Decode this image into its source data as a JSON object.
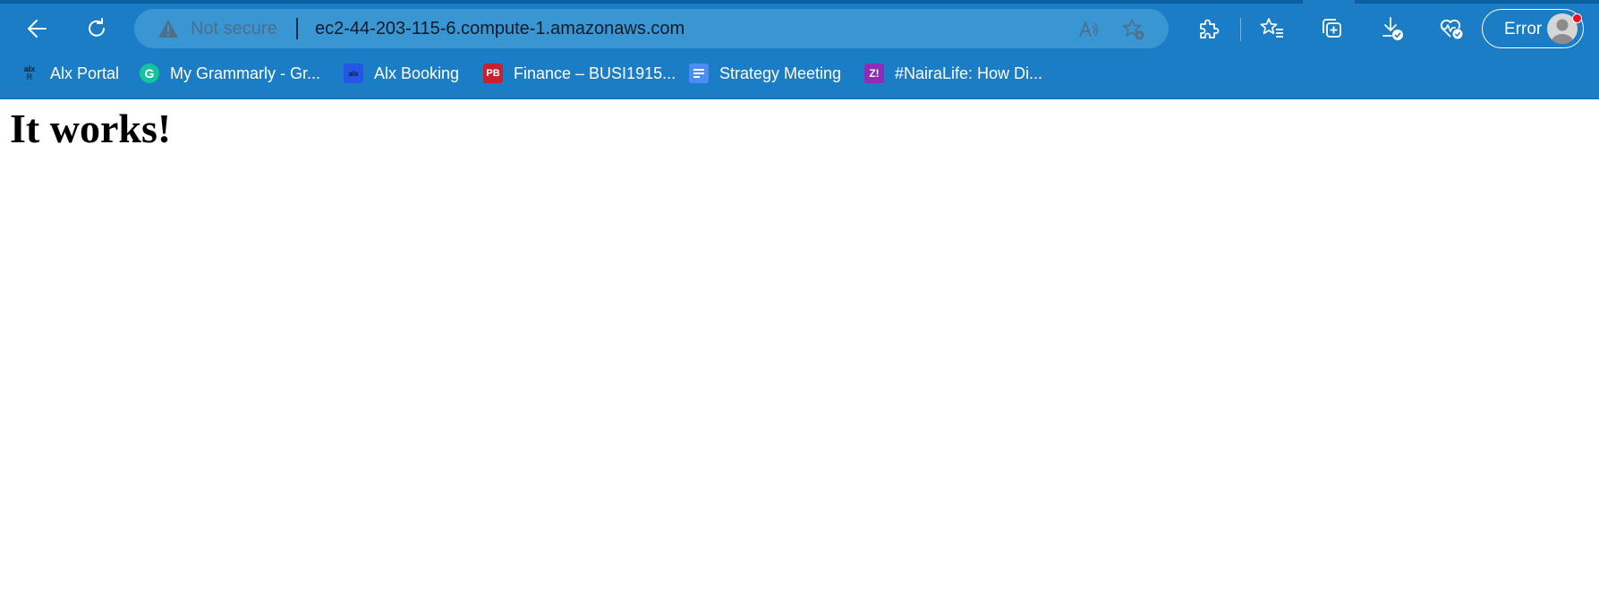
{
  "toolbar": {
    "back_icon": "back-arrow-icon",
    "refresh_icon": "refresh-icon",
    "extensions_icon": "puzzle-piece-icon",
    "favorites_icon": "favorites-list-icon",
    "collections_icon": "collections-icon",
    "downloads_icon": "download-icon",
    "health_icon": "browser-essentials-icon"
  },
  "address_bar": {
    "security_label": "Not secure",
    "url": "ec2-44-203-115-6.compute-1.amazonaws.com",
    "read_aloud_icon": "read-aloud-icon",
    "add_favorite_icon": "add-favorite-icon"
  },
  "profile": {
    "label": "Error",
    "status_color": "#e81123"
  },
  "bookmarks": [
    {
      "label": "Alx Portal",
      "icon": "alx-r-icon"
    },
    {
      "label": "My Grammarly - Gr...",
      "icon": "grammarly-icon",
      "color": "#15c39a"
    },
    {
      "label": "Alx Booking",
      "icon": "alx-icon",
      "color": "#2457e6"
    },
    {
      "label": "Finance – BUSI1915...",
      "icon": "pb-icon",
      "icon_text": "PB",
      "color": "#c8202f"
    },
    {
      "label": "Strategy Meeting",
      "icon": "google-docs-icon",
      "color": "#4b8cf5"
    },
    {
      "label": "#NairaLife: How Di...",
      "icon": "zikoko-icon",
      "icon_text": "Z!",
      "color": "#8e2cb8"
    }
  ],
  "page": {
    "heading": "It works!"
  },
  "colors": {
    "chrome": "#1a7dc6",
    "address_bar": "#3a96d3"
  }
}
